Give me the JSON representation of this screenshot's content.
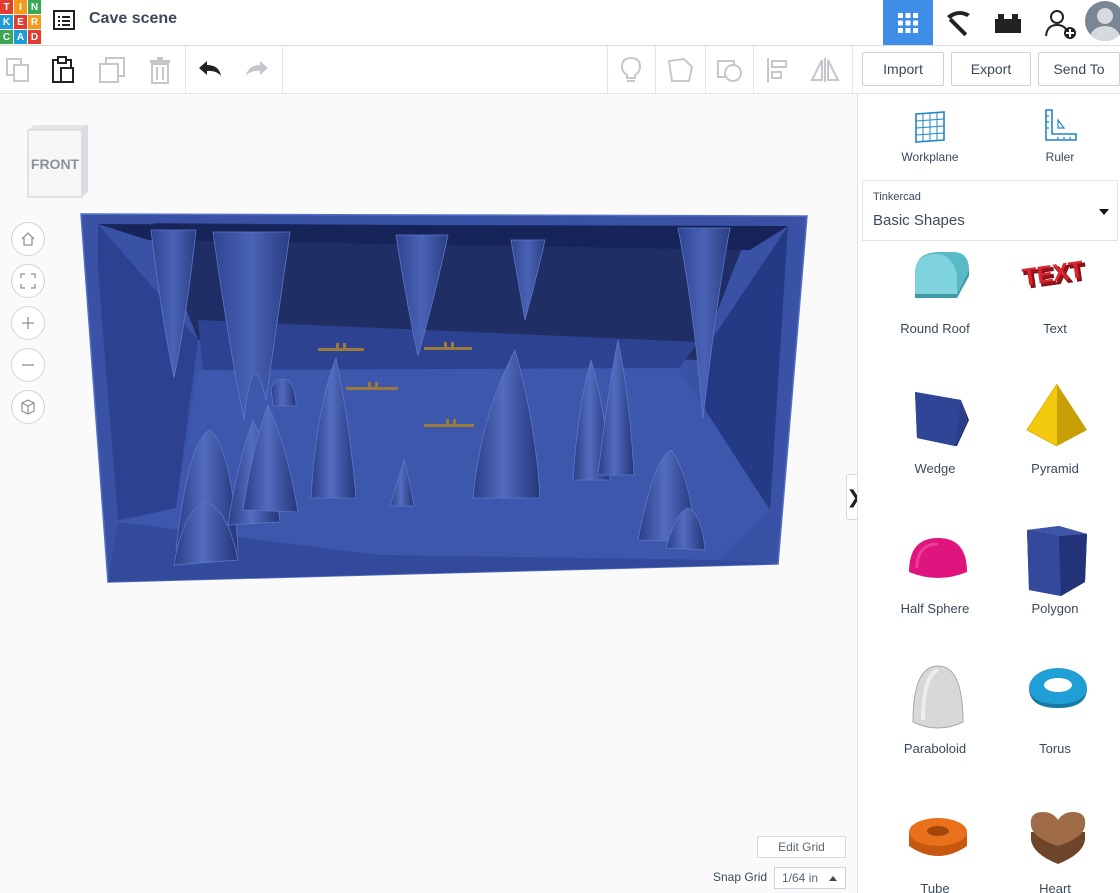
{
  "logo": {
    "letters": [
      "T",
      "I",
      "N",
      "K",
      "E",
      "R",
      "C",
      "A",
      "D"
    ]
  },
  "header": {
    "title": "Cave scene",
    "modes": [
      "3d-design-icon",
      "pickaxe-icon",
      "bricks-icon"
    ],
    "profile": "add-user-icon"
  },
  "toolbar": {
    "tools": [
      "copy-icon",
      "paste-icon",
      "duplicate-icon",
      "delete-icon",
      "undo-icon",
      "redo-icon"
    ],
    "view_tools": [
      "lightbulb-icon",
      "note-icon",
      "camera-icon",
      "align-icon",
      "mirror-icon"
    ],
    "import_label": "Import",
    "export_label": "Export",
    "send_label": "Send To"
  },
  "viewport": {
    "viewcube_label": "FRONT",
    "nav": [
      "home-icon",
      "fit-icon",
      "zoom-in-icon",
      "zoom-out-icon",
      "perspective-icon"
    ],
    "edit_grid_label": "Edit Grid",
    "snap_label": "Snap Grid",
    "snap_value": "1/64 in",
    "collapse_glyph": "❯"
  },
  "panel": {
    "workplane_label": "Workplane",
    "ruler_label": "Ruler",
    "library": {
      "source": "Tinkercad",
      "name": "Basic Shapes"
    },
    "shapes": [
      {
        "label": "Round Roof",
        "color": "#6cc7d3"
      },
      {
        "label": "Text",
        "color": "#c8202c"
      },
      {
        "label": "Wedge",
        "color": "#293d8a"
      },
      {
        "label": "Pyramid",
        "color": "#f2c90c"
      },
      {
        "label": "Half Sphere",
        "color": "#e0147e"
      },
      {
        "label": "Polygon",
        "color": "#2c3f8c"
      },
      {
        "label": "Paraboloid",
        "color": "#d8d8d8"
      },
      {
        "label": "Torus",
        "color": "#1f9fd6"
      },
      {
        "label": "Tube",
        "color": "#e9711c"
      },
      {
        "label": "Heart",
        "color": "#8b5a3a"
      }
    ]
  },
  "colors": {
    "accent": "#3e8ee8",
    "scene_blue": "#3b54a8",
    "scene_dark": "#1d2d62"
  }
}
